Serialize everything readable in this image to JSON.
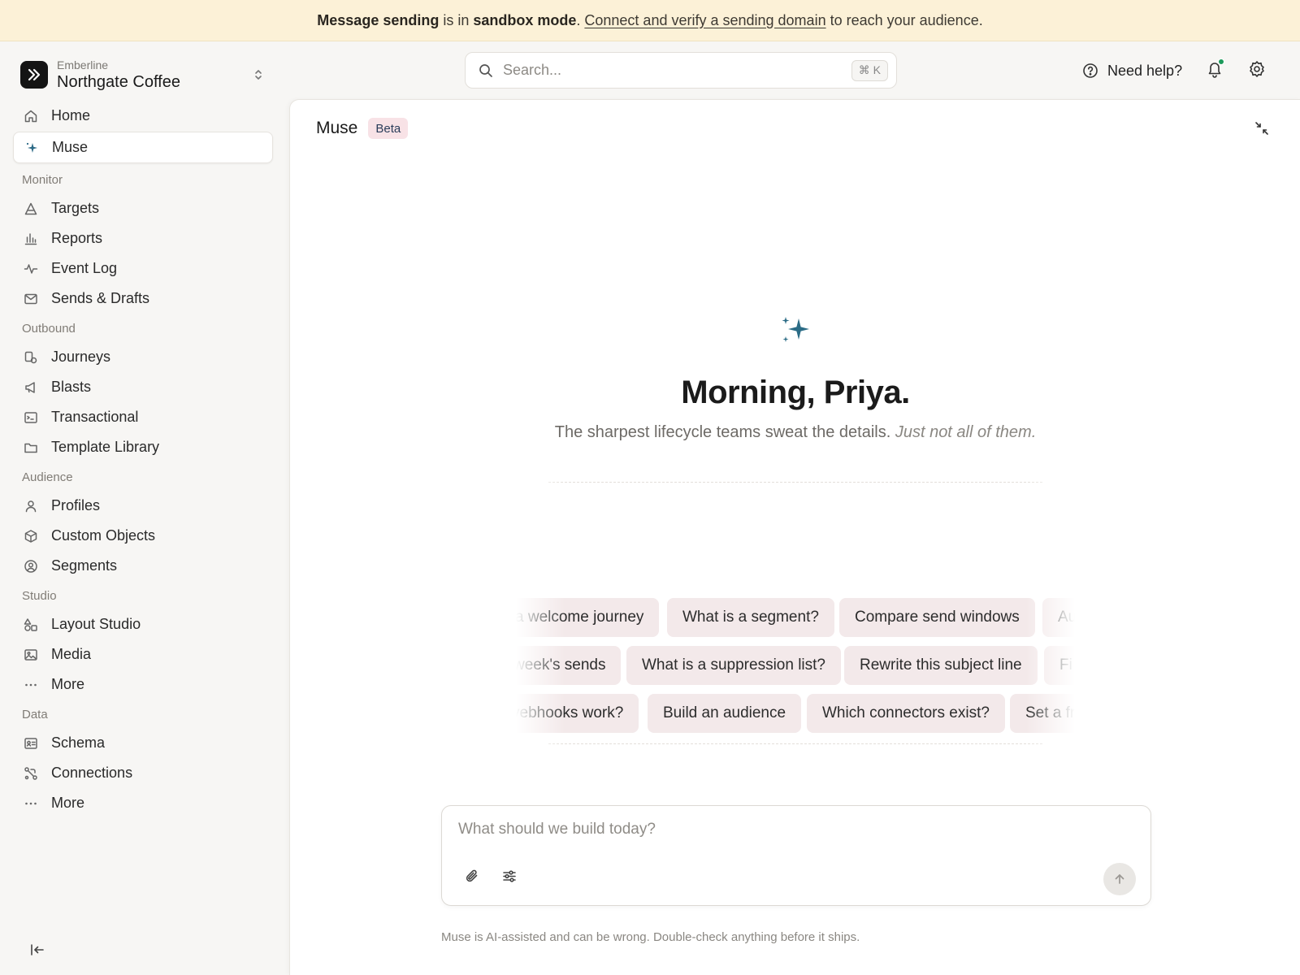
{
  "banner": {
    "part1": "Message sending",
    "part2": " is in ",
    "part3": "sandbox mode",
    "part4": ".",
    "link": "Connect and verify a sending domain",
    "part5": "to reach your audience."
  },
  "workspace": {
    "org": "Emberline",
    "name": "Northgate Coffee"
  },
  "nav": {
    "home": "Home",
    "muse": "Muse",
    "monitor": {
      "title": "Monitor",
      "targets": "Targets",
      "reports": "Reports",
      "event_log": "Event Log",
      "sends_drafts": "Sends & Drafts"
    },
    "outbound": {
      "title": "Outbound",
      "journeys": "Journeys",
      "blasts": "Blasts",
      "transactional": "Transactional",
      "template_library": "Template Library"
    },
    "audience": {
      "title": "Audience",
      "profiles": "Profiles",
      "custom_objects": "Custom Objects",
      "segments": "Segments"
    },
    "studio": {
      "title": "Studio",
      "layout_studio": "Layout Studio",
      "media": "Media",
      "more": "More"
    },
    "data": {
      "title": "Data",
      "schema": "Schema",
      "connections": "Connections",
      "more": "More"
    }
  },
  "topbar": {
    "search_placeholder": "Search...",
    "search_shortcut": "⌘ K",
    "help": "Need help?"
  },
  "panel": {
    "title": "Muse",
    "badge": "Beta",
    "greeting": "Morning, Priya.",
    "tagline_main": "The sharpest lifecycle teams sweat the details.",
    "tagline_italic": "Just not all of them.",
    "chips_row1": [
      "a welcome journey",
      "What is a segment?",
      "Compare send windows",
      "Au"
    ],
    "chips_row2": [
      "week's sends",
      "What is a suppression list?",
      "Rewrite this subject line",
      "Fi"
    ],
    "chips_row3": [
      "vebhooks work?",
      "Build an audience",
      "Which connectors exist?",
      "Set a fr"
    ],
    "composer_placeholder": "What should we build today?",
    "disclaimer": "Muse is AI-assisted and can be wrong. Double-check anything before it ships."
  }
}
